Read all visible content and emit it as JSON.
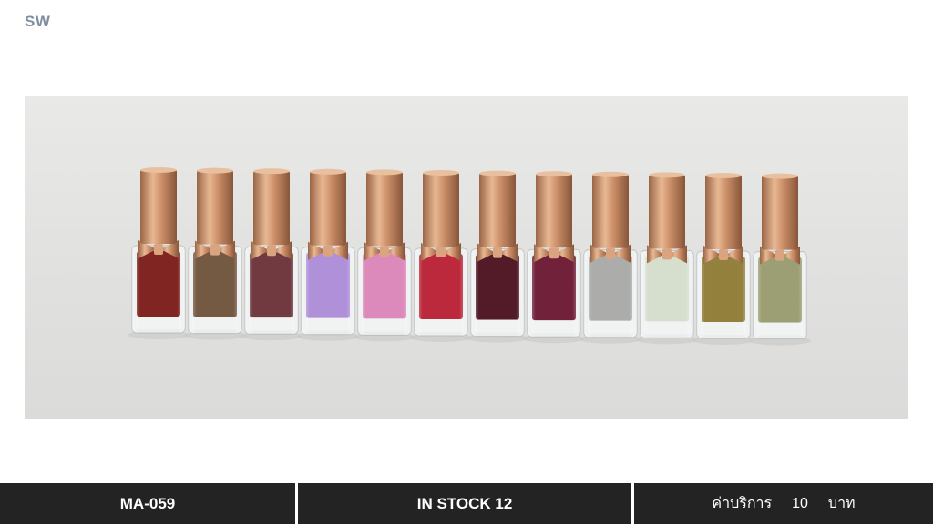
{
  "header": {
    "brand": "SW"
  },
  "product_image": {
    "alt": "nail polish bottles",
    "bottles": [
      {
        "color": "#7a1a16"
      },
      {
        "color": "#6e5139"
      },
      {
        "color": "#6a3037"
      },
      {
        "color": "#ab8ad7"
      },
      {
        "color": "#da84b8"
      },
      {
        "color": "#b81e32"
      },
      {
        "color": "#4a0f1c"
      },
      {
        "color": "#6b1530"
      },
      {
        "color": "#a8a8a6"
      },
      {
        "color": "#d4dccb"
      },
      {
        "color": "#8e7a34"
      },
      {
        "color": "#979a6d"
      }
    ],
    "cap_color": "#c9906a"
  },
  "footer": {
    "code": "MA-059",
    "stock": "IN  STOCK  12",
    "price_label": "ค่าบริการ",
    "price_value": "10",
    "price_unit": "บาท"
  }
}
